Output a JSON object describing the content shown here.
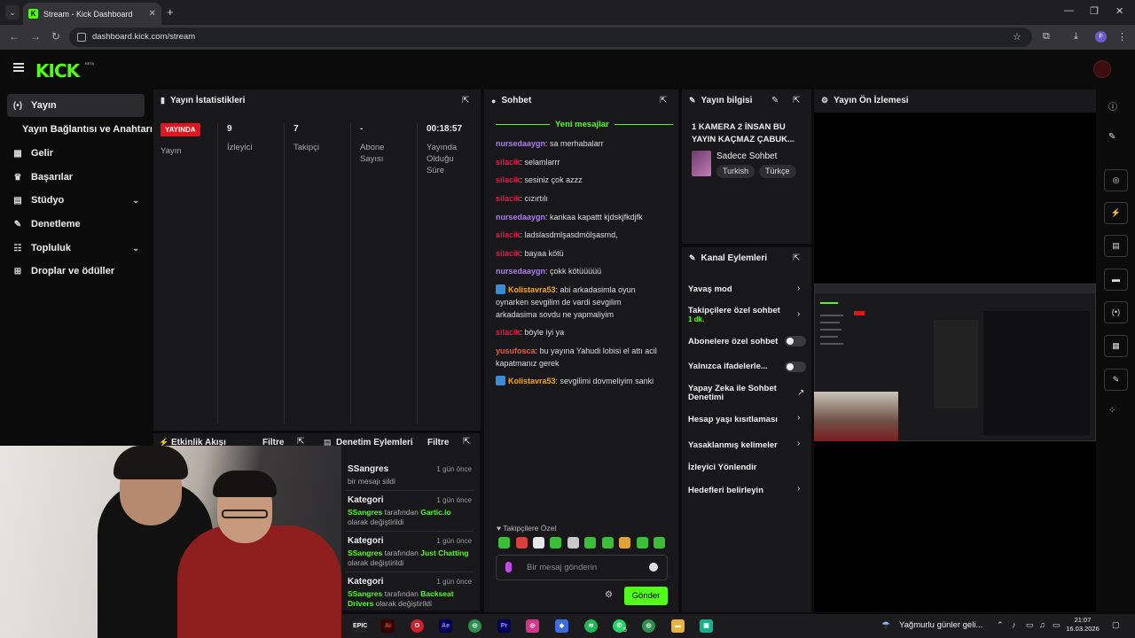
{
  "browser": {
    "tab_title": "Stream - Kick Dashboard",
    "url": "dashboard.kick.com/stream"
  },
  "header": {
    "logo": "KICK",
    "beta": "BETA"
  },
  "sidebar": {
    "items": [
      {
        "label": "Yayın",
        "icon": "broadcast-icon",
        "glyph": "(•)"
      },
      {
        "label": "Yayın Bağlantısı ve Anahtarı",
        "icon": "",
        "glyph": ""
      },
      {
        "label": "Gelir",
        "icon": "revenue-icon",
        "glyph": "▦"
      },
      {
        "label": "Başarılar",
        "icon": "trophy-icon",
        "glyph": "🏆"
      },
      {
        "label": "Stüdyo",
        "icon": "studio-icon",
        "glyph": "▤"
      },
      {
        "label": "Denetleme",
        "icon": "wrench-icon",
        "glyph": "🔧"
      },
      {
        "label": "Topluluk",
        "icon": "community-icon",
        "glyph": "👥"
      },
      {
        "label": "Droplar ve ödüller",
        "icon": "drops-icon",
        "glyph": "⚙"
      }
    ]
  },
  "stats": {
    "title": "Yayın İstatistikleri",
    "live_badge": "YAYINDA",
    "cols": [
      {
        "value": "",
        "label": "Yayın"
      },
      {
        "value": "9",
        "label": "İzleyici"
      },
      {
        "value": "7",
        "label": "Takipçi"
      },
      {
        "value": "-",
        "label": "Abone Sayısı"
      },
      {
        "value": "00:18:57",
        "label": "Yayında Olduğu Süre"
      }
    ]
  },
  "activity": {
    "title": "Etkinlik Akışı",
    "filter": "Filtre"
  },
  "mod": {
    "title": "Denetim Eylemleri",
    "filter": "Filtre",
    "entries": [
      {
        "title": "SSangres",
        "time": "1 gün önce",
        "line1": "bir mesajı sildi",
        "a": "",
        "b": "",
        "c": ""
      },
      {
        "title": "Kategori",
        "time": "1 gün önce",
        "a": "SSangres",
        "b": " tarafından ",
        "c": "Gartic.io",
        "d": " olarak değiştirildi"
      },
      {
        "title": "Kategori",
        "time": "1 gün önce",
        "a": "SSangres",
        "b": " tarafından ",
        "c": "Just Chatting",
        "d": " olarak değiştirildi"
      },
      {
        "title": "Kategori",
        "time": "1 gün önce",
        "a": "SSangres",
        "b": " tarafından ",
        "c": "Backseat Drivers",
        "d": " olarak değiştirildi"
      }
    ]
  },
  "chat": {
    "title": "Sohbet",
    "new_messages": "Yeni mesajlar",
    "messages": [
      {
        "user": "nursedaaygn",
        "text": " sa merhabalarr",
        "cls": "u-g"
      },
      {
        "user": "silacik",
        "text": " selamlarrr",
        "cls": "u-r"
      },
      {
        "user": "silacik",
        "text": " sesiniz çok azzz",
        "cls": "u-r"
      },
      {
        "user": "silacik",
        "text": " cızırtılı",
        "cls": "u-r"
      },
      {
        "user": "nursedaaygn",
        "text": " kankaa kapattt kjdskjfkdjfk",
        "cls": "u-g"
      },
      {
        "user": "silacik",
        "text": " ladslasdmlşasdmölşasmd,",
        "cls": "u-r"
      },
      {
        "user": "silacik",
        "text": " bayaa kötü",
        "cls": "u-r"
      },
      {
        "user": "nursedaaygn",
        "text": " çokk kötüüüüü",
        "cls": "u-g"
      },
      {
        "user": "Kolistavra53",
        "text": " abi arkadasimla oyun oynarken sevgilim de vardi sevgilim arkadasima sovdu ne yapmaliyim",
        "cls": "u-y"
      },
      {
        "user": "silacik",
        "text": " böyle iyi ya",
        "cls": "u-r"
      },
      {
        "user": "yusufosca",
        "text": " bu yayına Yahudi lobisi el attı acil kapatmanız gerek",
        "cls": "u-o"
      },
      {
        "user": "Kolistavra53",
        "text": " sevgilimi dovmeliyim sanki",
        "cls": "u-y"
      }
    ],
    "emotes_label": "Takipçilere Özel",
    "placeholder": "Bir mesaj gönderin",
    "send": "Gönder"
  },
  "stream_info": {
    "title_label": "Yayın bilgisi",
    "stream_title": "1 KAMERA 2 İNSAN BU YAYIN KAÇMAZ ÇABUK...",
    "category": "Sadece Sohbet",
    "tags": [
      "Turkish",
      "Türkçe"
    ]
  },
  "channel_actions": {
    "title": "Kanal Eylemleri",
    "items": [
      {
        "label": "Yavaş mod",
        "sub": ""
      },
      {
        "label": "Takipçilere özel sohbet",
        "sub": "1 dk."
      },
      {
        "label": "Abonelere özel sohbet",
        "sub": ""
      },
      {
        "label": "Yalnızca ifadelerle...",
        "sub": ""
      },
      {
        "label": "Yapay Zeka ile Sohbet Denetimi",
        "sub": ""
      },
      {
        "label": "Hesap yaşı kısıtlaması",
        "sub": ""
      },
      {
        "label": "Yasaklanmış kelimeler",
        "sub": ""
      },
      {
        "label": "İzleyici Yönlendir",
        "sub": ""
      },
      {
        "label": "Hedefleri belirleyin",
        "sub": ""
      }
    ]
  },
  "preview": {
    "title": "Yayın Ön İzlemesi"
  },
  "taskbar": {
    "weather": "Yağmurlu günler geli...",
    "time": "21:07",
    "date": "16.03.2026",
    "notif_count": "5"
  },
  "colors": {
    "accent": "#53fc18",
    "live": "#e5131b",
    "panel": "#18181b"
  }
}
